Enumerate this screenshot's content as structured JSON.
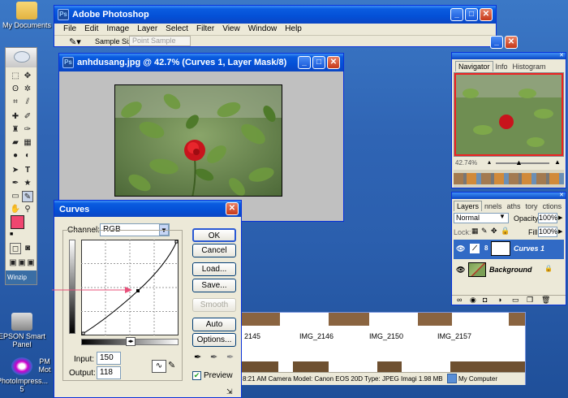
{
  "desktop": {
    "icons": [
      {
        "label": "My Documents"
      },
      {
        "label": "EPSON Smart Panel"
      },
      {
        "label": "PhotoImpress... 5"
      },
      {
        "label": "PM Mot"
      }
    ]
  },
  "photoshop": {
    "title": "Adobe Photoshop",
    "menu": [
      "File",
      "Edit",
      "Image",
      "Layer",
      "Select",
      "Filter",
      "View",
      "Window",
      "Help"
    ],
    "options_bar": {
      "sample_size_label": "Sample Size:",
      "sample_size_value": "Point Sample"
    }
  },
  "toolbox": {
    "footer": "Winzip"
  },
  "document": {
    "title": "anhdusang.jpg @ 42.7% (Curves 1, Layer Mask/8)"
  },
  "navigator": {
    "tabs": [
      "Navigator",
      "Info",
      "Histogram"
    ],
    "zoom": "42.74%"
  },
  "layers": {
    "tabs": [
      "Layers",
      "nnels",
      "aths",
      "tory",
      "ctions"
    ],
    "blend_mode": "Normal",
    "opacity_label": "Opacity:",
    "opacity": "100%",
    "lock_label": "Lock:",
    "fill_label": "Fill:",
    "fill": "100%",
    "items": [
      {
        "name": "Curves 1",
        "selected": true
      },
      {
        "name": "Background",
        "selected": false
      }
    ]
  },
  "curves": {
    "title": "Curves",
    "channel_label": "Channel:",
    "channel": "RGB",
    "input_label": "Input:",
    "input": "150",
    "output_label": "Output:",
    "output": "118",
    "buttons": {
      "ok": "OK",
      "cancel": "Cancel",
      "load": "Load...",
      "save": "Save...",
      "smooth": "Smooth",
      "auto": "Auto",
      "options": "Options..."
    },
    "preview_label": "Preview",
    "preview_checked": true
  },
  "explorer": {
    "files": [
      "2145",
      "IMG_2146",
      "IMG_2150",
      "IMG_2157"
    ],
    "status": "8:21 AM Camera Model: Canon EOS 20D Type: JPEG Imagi 1.98 MB",
    "location": "My Computer"
  },
  "colors": {
    "foreground": "#f0466f",
    "accent": "#316ac5"
  }
}
